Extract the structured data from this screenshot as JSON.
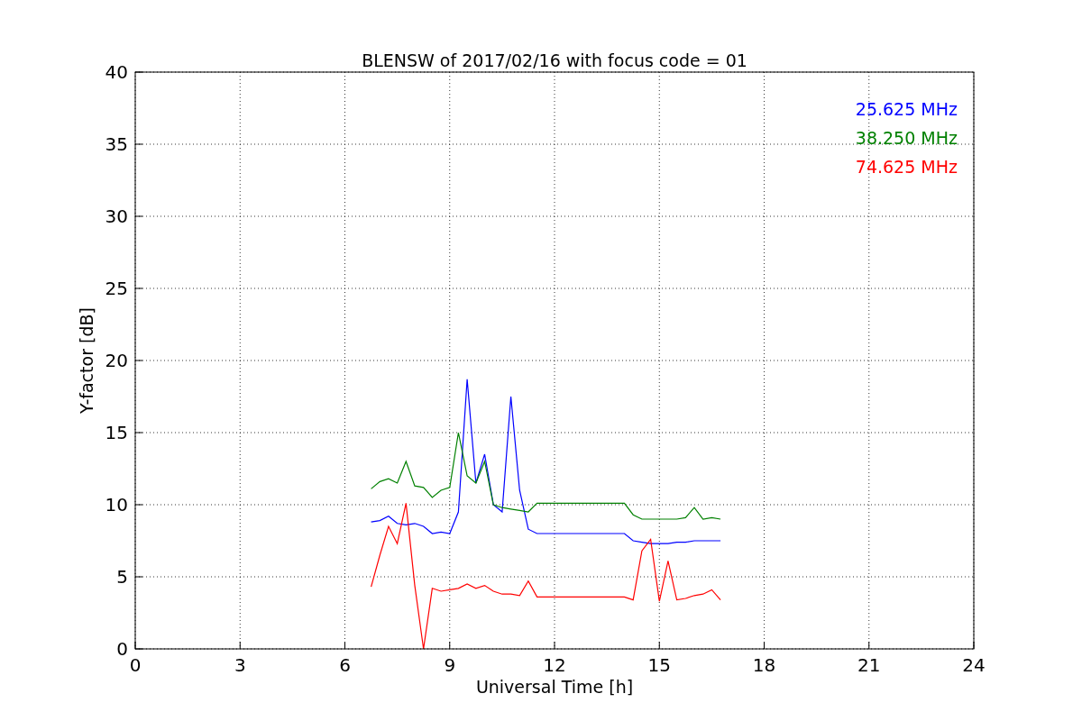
{
  "chart_data": {
    "type": "line",
    "title": "BLENSW of 2017/02/16 with focus code = 01",
    "xlabel": "Universal Time [h]",
    "ylabel": "Y-factor [dB]",
    "x": [
      6.75,
      7,
      7.25,
      7.5,
      7.75,
      8,
      8.25,
      8.5,
      8.75,
      9,
      9.25,
      9.5,
      9.75,
      10,
      10.25,
      10.5,
      10.75,
      11,
      11.25,
      11.5,
      11.75,
      12,
      12.25,
      12.5,
      12.75,
      13,
      13.25,
      13.5,
      13.75,
      14,
      14.25,
      14.5,
      14.75,
      15,
      15.25,
      15.5,
      15.75,
      16,
      16.25,
      16.5,
      16.75
    ],
    "series": [
      {
        "name": "25.625 MHz",
        "color": "#0000ff",
        "values": [
          8.8,
          8.9,
          9.2,
          8.7,
          8.6,
          8.7,
          8.5,
          8.0,
          8.1,
          8.0,
          9.5,
          18.7,
          11.5,
          13.5,
          10.0,
          9.5,
          17.5,
          11.0,
          8.3,
          8.0,
          8.0,
          8.0,
          8.0,
          8.0,
          8.0,
          8.0,
          8.0,
          8.0,
          8.0,
          8.0,
          7.5,
          7.4,
          7.3,
          7.3,
          7.3,
          7.4,
          7.4,
          7.5,
          7.5,
          7.5,
          7.5
        ]
      },
      {
        "name": "38.250 MHz",
        "color": "#008000",
        "values": [
          11.1,
          11.6,
          11.8,
          11.5,
          13.0,
          11.3,
          11.2,
          10.5,
          11.0,
          11.2,
          15.0,
          12.0,
          11.5,
          13.0,
          10.0,
          9.8,
          9.7,
          9.6,
          9.5,
          10.1,
          10.1,
          10.1,
          10.1,
          10.1,
          10.1,
          10.1,
          10.1,
          10.1,
          10.1,
          10.1,
          9.3,
          9.0,
          9.0,
          9.0,
          9.0,
          9.0,
          9.1,
          9.8,
          9.0,
          9.1,
          9.0
        ]
      },
      {
        "name": "74.625 MHz",
        "color": "#ff0000",
        "values": [
          4.3,
          6.5,
          8.5,
          7.3,
          10.1,
          4.4,
          0.0,
          4.2,
          4.0,
          4.1,
          4.2,
          4.5,
          4.2,
          4.4,
          4.0,
          3.8,
          3.8,
          3.7,
          4.7,
          3.6,
          3.6,
          3.6,
          3.6,
          3.6,
          3.6,
          3.6,
          3.6,
          3.6,
          3.6,
          3.6,
          3.4,
          6.8,
          7.6,
          3.3,
          6.1,
          3.4,
          3.5,
          3.7,
          3.8,
          4.1,
          3.4
        ]
      }
    ],
    "grid": true,
    "xlim": [
      0,
      24
    ],
    "ylim": [
      0,
      40
    ],
    "xticks": [
      0,
      3,
      6,
      9,
      12,
      15,
      18,
      21,
      24
    ],
    "yticks": [
      0,
      5,
      10,
      15,
      20,
      25,
      30,
      35,
      40
    ]
  }
}
